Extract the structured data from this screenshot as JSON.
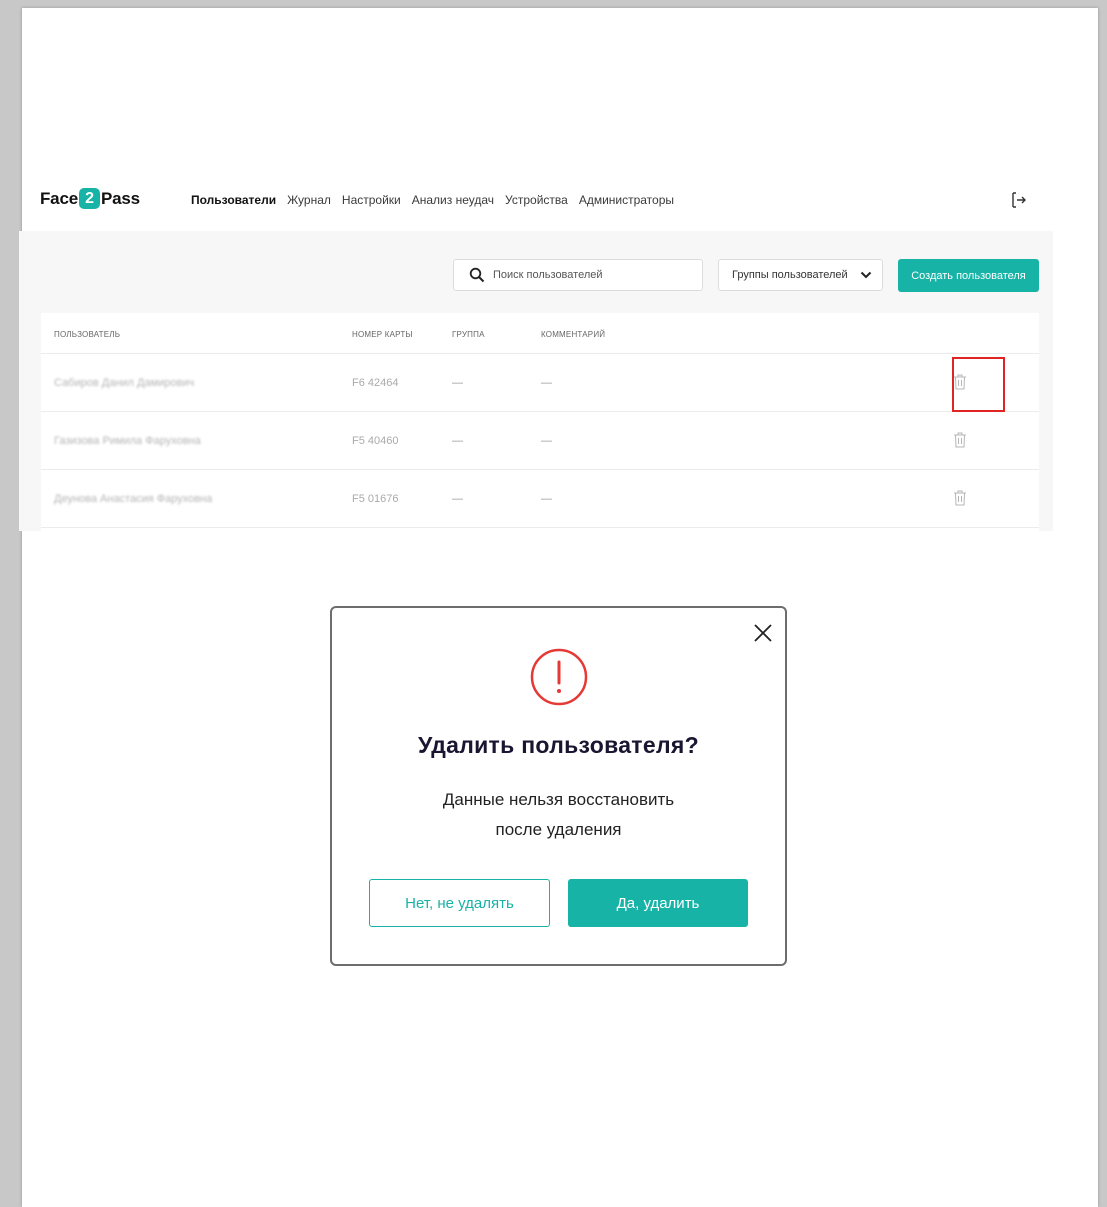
{
  "app": {
    "logo_prefix": "Face",
    "logo_number": "2",
    "logo_suffix": "Pass"
  },
  "nav": {
    "items": [
      "Пользователи",
      "Журнал",
      "Настройки",
      "Анализ неудач",
      "Устройства",
      "Администраторы"
    ],
    "active": "Пользователи"
  },
  "toolbar": {
    "search_placeholder": "Поиск пользователей",
    "groups_label": "Группы пользователей",
    "create_label": "Создать пользователя"
  },
  "table": {
    "headers": {
      "user": "ПОЛЬЗОВАТЕЛЬ",
      "card": "НОМЕР КАРТЫ",
      "group": "ГРУППА",
      "comment": "КОММЕНТАРИЙ"
    },
    "rows": [
      {
        "name": "Сабиров Данил Дамирович",
        "card": "F6 42464",
        "group": "—",
        "comment": "—"
      },
      {
        "name": "Газизова Римила Фаруховна",
        "card": "F5 40460",
        "group": "—",
        "comment": "—"
      },
      {
        "name": "Деунова Анастасия Фаруховна",
        "card": "F5 01676",
        "group": "—",
        "comment": "—"
      }
    ]
  },
  "modal": {
    "title": "Удалить пользователя?",
    "message_line1": "Данные нельзя восстановить",
    "message_line2": "после удаления",
    "cancel_label": "Нет, не удалять",
    "confirm_label": "Да, удалить"
  },
  "colors": {
    "accent": "#17b3a6",
    "alert": "#e53935",
    "highlight": "#e02424"
  },
  "icons": {
    "search": "search-icon",
    "dropdown": "chevron-down-icon",
    "logout": "logout-icon",
    "delete": "trash-icon",
    "close": "close-icon",
    "alert": "alert-circle-icon"
  }
}
